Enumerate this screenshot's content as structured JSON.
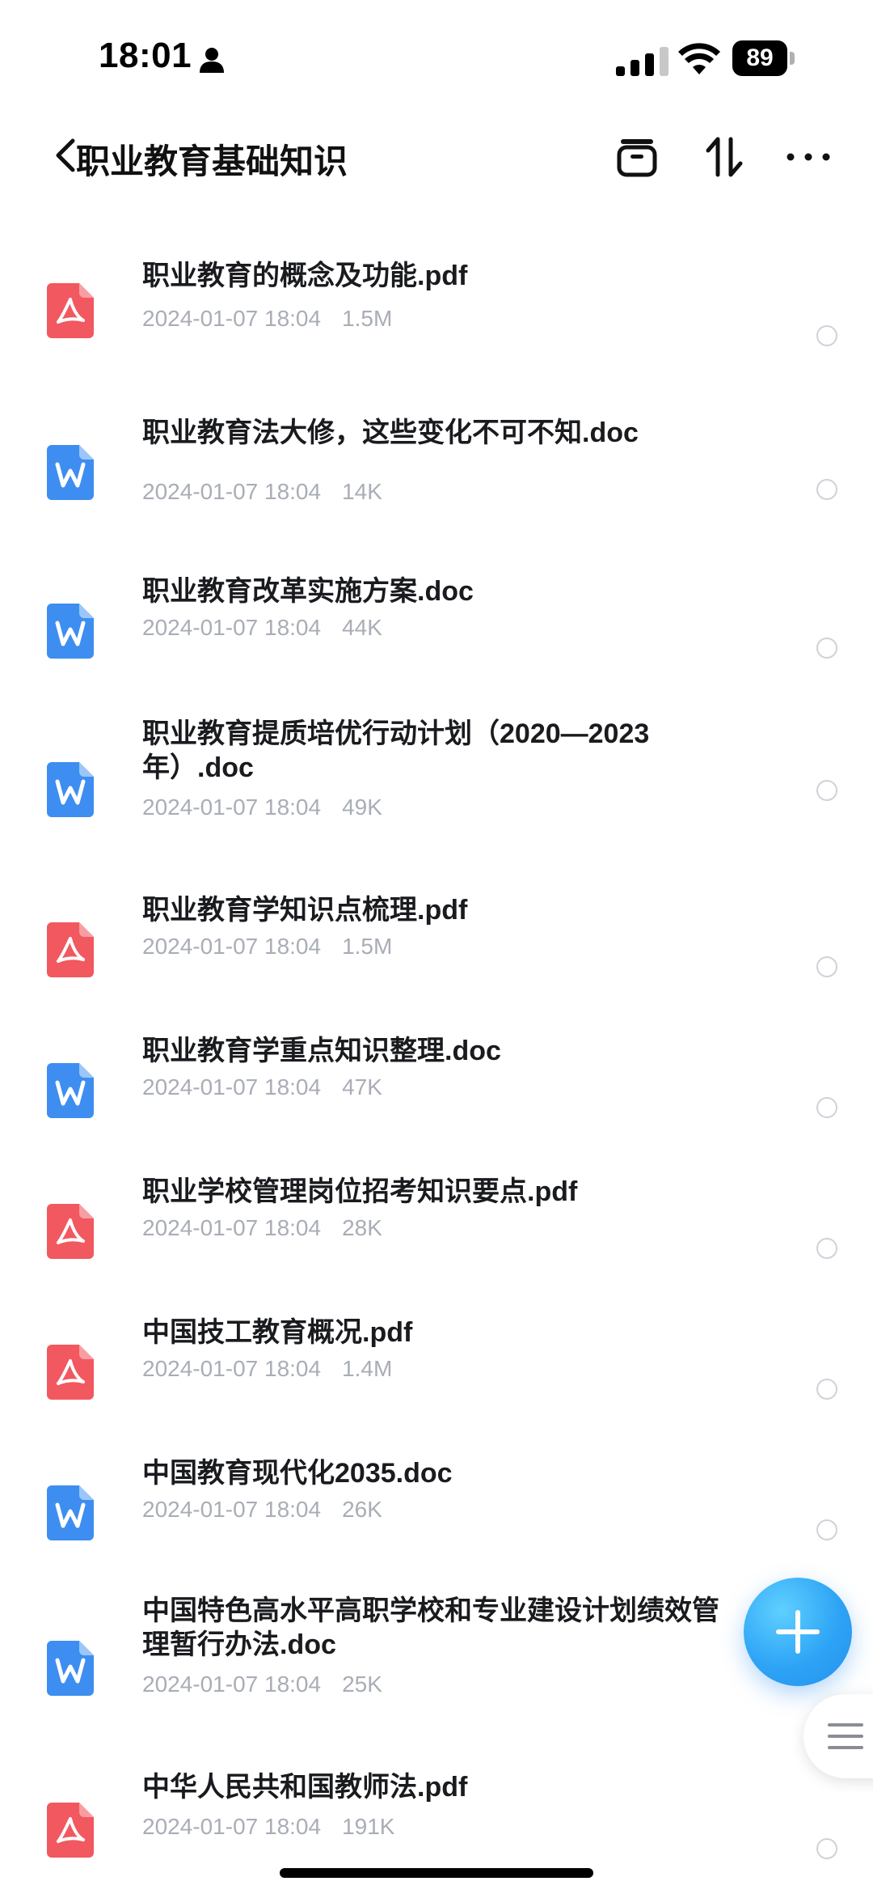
{
  "status_bar": {
    "time": "18:01",
    "battery": "89"
  },
  "header": {
    "title": "职业教育基础知识",
    "icons": [
      "back-chevron-icon",
      "archive-icon",
      "sort-icon",
      "more-icon"
    ]
  },
  "files": [
    {
      "name": "职业教育的概念及功能.pdf",
      "date": "2024-01-07 18:04",
      "size": "1.5M",
      "type": "pdf"
    },
    {
      "name": "职业教育法大修，这些变化不可不知.doc",
      "date": "2024-01-07 18:04",
      "size": "14K",
      "type": "doc"
    },
    {
      "name": "职业教育改革实施方案.doc",
      "date": "2024-01-07 18:04",
      "size": "44K",
      "type": "doc"
    },
    {
      "name": "职业教育提质培优行动计划（2020—2023年）.doc",
      "date": "2024-01-07 18:04",
      "size": "49K",
      "type": "doc"
    },
    {
      "name": "职业教育学知识点梳理.pdf",
      "date": "2024-01-07 18:04",
      "size": "1.5M",
      "type": "pdf"
    },
    {
      "name": "职业教育学重点知识整理.doc",
      "date": "2024-01-07 18:04",
      "size": "47K",
      "type": "doc"
    },
    {
      "name": "职业学校管理岗位招考知识要点.pdf",
      "date": "2024-01-07 18:04",
      "size": "28K",
      "type": "pdf"
    },
    {
      "name": "中国技工教育概况.pdf",
      "date": "2024-01-07 18:04",
      "size": "1.4M",
      "type": "pdf"
    },
    {
      "name": "中国教育现代化2035.doc",
      "date": "2024-01-07 18:04",
      "size": "26K",
      "type": "doc"
    },
    {
      "name": "中国特色高水平高职学校和专业建设计划绩效管理暂行办法.doc",
      "date": "2024-01-07 18:04",
      "size": "25K",
      "type": "doc"
    },
    {
      "name": "中华人民共和国教师法.pdf",
      "date": "2024-01-07 18:04",
      "size": "191K",
      "type": "pdf"
    }
  ],
  "colors": {
    "pdf_icon": "#f2585f",
    "doc_icon": "#3d8ef0",
    "fab": "#2ea4f6",
    "meta_text": "#a9adb6"
  },
  "floating": {
    "fab_icon": "plus-icon",
    "side_handle_icon": "menu-lines-icon"
  }
}
